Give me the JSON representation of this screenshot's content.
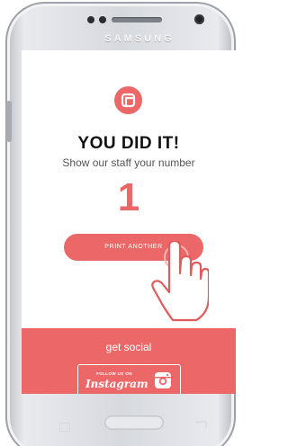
{
  "device": {
    "brand": "SAMSUNG"
  },
  "screen": {
    "title": "YOU DID IT!",
    "subtitle": "Show our staff your number",
    "number": "1",
    "print_button": "PRINT ANOTHER"
  },
  "social": {
    "heading": "get social",
    "follow_label": "FOLLOW US ON",
    "instagram_word": "Instagram"
  },
  "icons": {
    "logo": "photo-booth-logo-icon",
    "instagram": "instagram-icon",
    "hand": "tap-hand-icon"
  },
  "colors": {
    "accent": "#ec6767",
    "text_dark": "#111111",
    "text_muted": "#555555",
    "background": "#ffffff"
  }
}
